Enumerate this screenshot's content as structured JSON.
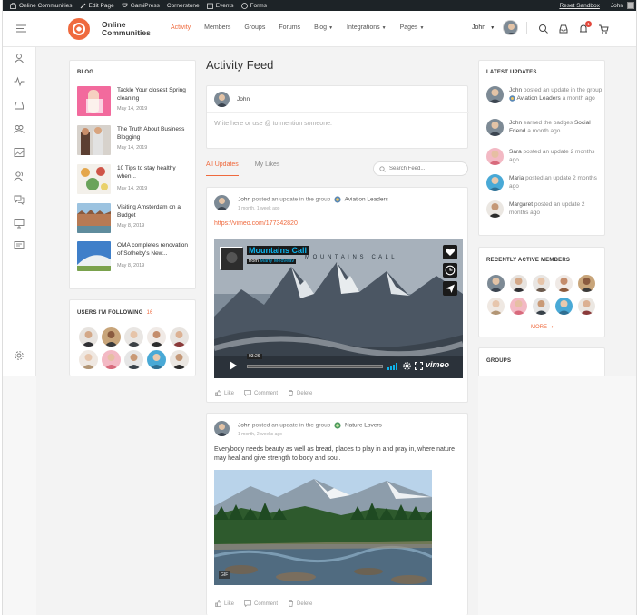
{
  "adminbar": {
    "site_name": "Online Communities",
    "edit_page": "Edit Page",
    "gamipress": "GamiPress",
    "cornerstone": "Cornerstone",
    "events": "Events",
    "forms": "Forms",
    "reset": "Reset Sandbox",
    "user": "John"
  },
  "header": {
    "brand_line1": "Online",
    "brand_line2": "Communities",
    "nav": [
      {
        "label": "Activity",
        "active": true
      },
      {
        "label": "Members"
      },
      {
        "label": "Groups"
      },
      {
        "label": "Forums"
      },
      {
        "label": "Blog",
        "dropdown": true
      },
      {
        "label": "Integrations",
        "dropdown": true
      },
      {
        "label": "Pages",
        "dropdown": true
      }
    ],
    "user_name": "John",
    "notification_count": "1",
    "accent": "#ef6a3e"
  },
  "blog": {
    "title": "BLOG",
    "items": [
      {
        "title": "Tackle Your closest Spring cleaning",
        "date": "May 14, 2019"
      },
      {
        "title": "The Truth About Business Blogging",
        "date": "May 14, 2019"
      },
      {
        "title": "10 Tips to stay healthy when...",
        "date": "May 14, 2019"
      },
      {
        "title": "Visiting Amsterdam on a Budget",
        "date": "May 8, 2019"
      },
      {
        "title": "OMA completes renovation of Sotheby's New...",
        "date": "May 8, 2019"
      }
    ]
  },
  "following": {
    "title": "USERS I'M FOLLOWING",
    "count": "16"
  },
  "feed": {
    "title": "Activity Feed",
    "composer_user": "John",
    "composer_placeholder": "Write here or use @ to mention someone.",
    "tabs": [
      "All Updates",
      "My Likes"
    ],
    "search_placeholder": "Search Feed...",
    "posts": [
      {
        "author": "John",
        "action": "posted an update in the group",
        "group": "Aviation Leaders",
        "time": "1 month, 1 week ago",
        "link": "https://vimeo.com/177342820",
        "video": {
          "title": "Mountains Call",
          "from_label": "from",
          "author": "Marty Medveav",
          "overlay": "M O U N T A I N S   C A L L",
          "time": "03:26",
          "brand": "vimeo"
        }
      },
      {
        "author": "John",
        "action": "posted an update in the group",
        "group": "Nature Lovers",
        "time": "1 month, 2 weeks ago",
        "text": "Everybody needs beauty as well as bread, places to play in and pray in, where nature may heal and give strength to body and soul.",
        "gif_badge": "GIF"
      }
    ],
    "actions": {
      "like": "Like",
      "comment": "Comment",
      "delete": "Delete"
    }
  },
  "latest_updates": {
    "title": "LATEST UPDATES",
    "items": [
      {
        "name": "John",
        "text": "posted an update in the group",
        "group": "Aviation Leaders",
        "time": "a month ago"
      },
      {
        "name": "John",
        "text": "earned the badges",
        "group": "Social Friend",
        "time": "a month ago"
      },
      {
        "name": "Sara",
        "text": "posted an update",
        "group": "",
        "time": "2 months ago"
      },
      {
        "name": "Maria",
        "text": "posted an update",
        "group": "",
        "time": "2 months ago"
      },
      {
        "name": "Margaret",
        "text": "posted an update",
        "group": "",
        "time": "2 months ago"
      }
    ]
  },
  "recent_members": {
    "title": "RECENTLY ACTIVE MEMBERS",
    "more": "MORE"
  },
  "groups": {
    "title": "GROUPS"
  }
}
